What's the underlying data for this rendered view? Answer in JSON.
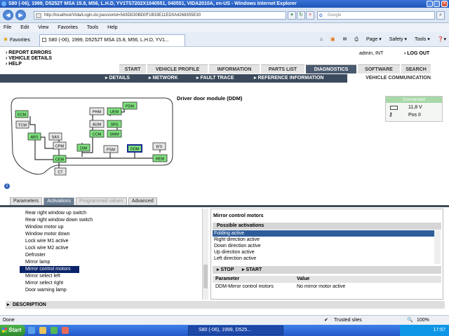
{
  "browser": {
    "title": "S80 (-06), 1999, D5252T MSA 15.8, M56, L.H.D, YV1TS7202X1040551, 040551, VIDA2010A, en-US - Windows Internet Explorer",
    "url": "http://localhost/Vida/Login.do;jsessionid=543DD30BD0F1B33E11ED0A4268355E30",
    "search_placeholder": "Google",
    "menu": [
      "File",
      "Edit",
      "View",
      "Favorites",
      "Tools",
      "Help"
    ],
    "favorites_label": "Favorites",
    "tab_title": "S80 (-06), 1999, D5252T MSA 15.8, M56, L.H.D, YV1...",
    "toolbar": [
      "Page ▾",
      "Safety ▾",
      "Tools ▾",
      "❓▾"
    ]
  },
  "app": {
    "top_links": [
      "REPORT ERRORS",
      "VEHICLE DETAILS",
      "HELP"
    ],
    "user": "admin, INT",
    "logout": "LOG OUT",
    "tabs": [
      {
        "label": "START",
        "active": false
      },
      {
        "label": "VEHICLE PROFILE",
        "active": false
      },
      {
        "label": "INFORMATION",
        "active": false
      },
      {
        "label": "PARTS LIST",
        "active": false
      },
      {
        "label": "DIAGNOSTICS",
        "active": true
      },
      {
        "label": "SOFTWARE",
        "active": false
      },
      {
        "label": "SEARCH",
        "active": false
      }
    ],
    "subtabs": [
      "DETAILS",
      "NETWORK",
      "FAULT TRACE",
      "REFERENCE INFORMATION"
    ],
    "subtab_active": "VEHICLE COMMUNICATION",
    "module_title": "Driver door module (DDM)",
    "modules": [
      "ECM",
      "TCM",
      "ABS",
      "SAS",
      "CPM",
      "CEM",
      "CT",
      "PHM",
      "AUM",
      "CCM",
      "DIM",
      "UEM",
      "SRS",
      "SWM",
      "PSM",
      "PDM",
      "DDM",
      "RTI",
      "REM"
    ],
    "connection": {
      "status": "Connected",
      "voltage": "11,8 V",
      "position": "Pos II",
      "status_color": "#a8d8a8"
    },
    "bottom_tabs": [
      {
        "label": "Parameters",
        "state": "normal"
      },
      {
        "label": "Activations",
        "state": "active"
      },
      {
        "label": "Programmed values",
        "state": "disabled"
      },
      {
        "label": "Advanced",
        "state": "normal"
      }
    ],
    "activation_items": [
      "Rear right window up switch",
      "Rear right window down switch",
      "Window motor up",
      "Window motor down",
      "Lock wire M1 active",
      "Lock wire M2 active",
      "Defroster",
      "Mirror lamp",
      "Mirror control motors",
      "Mirror select left",
      "Mirror select right",
      "Door warning lamp"
    ],
    "selected_item": "Mirror control motors",
    "detail": {
      "title": "Mirror control motors",
      "possible_header": "Possible activations",
      "possible": [
        "Folding active",
        "Right direction active",
        "Down direction active",
        "Up direction active",
        "Left direction active"
      ],
      "stop": "STOP",
      "start": "START",
      "col_param": "Parameter",
      "col_value": "Value",
      "row_param": "DDM-Mirror control motors",
      "row_value": "No mirror motor active"
    },
    "description_label": "DESCRIPTION"
  },
  "status_bar": {
    "done": "Done",
    "zone": "Trusted sites",
    "zoom": "100%"
  },
  "taskbar": {
    "start": "Start",
    "task": "S80 (-06), 1999, D525...",
    "clock": "17:57"
  }
}
